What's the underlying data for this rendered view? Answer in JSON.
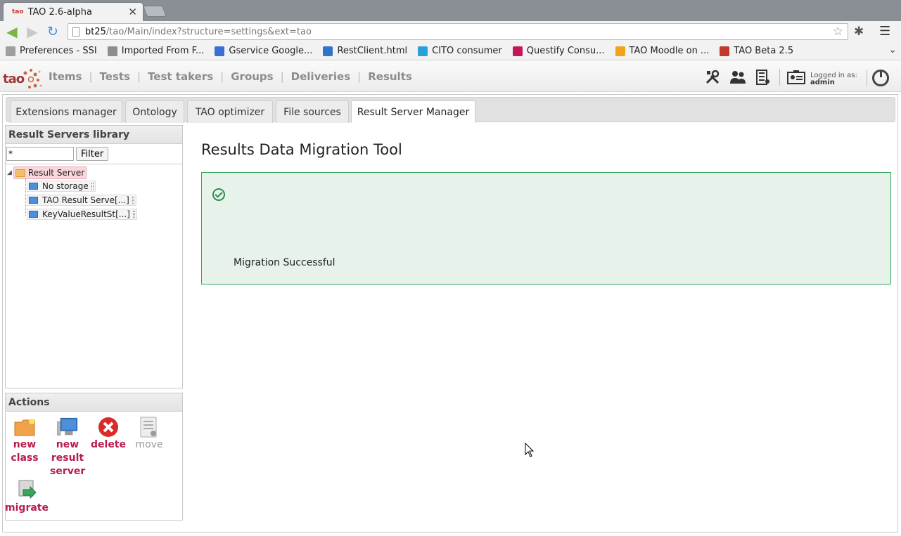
{
  "browser": {
    "tab_title": "TAO 2.6-alpha",
    "tab_favicon": "tao",
    "url_host": "bt25",
    "url_path": "/tao/Main/index?structure=settings&ext=tao",
    "bookmarks": [
      {
        "label": "Preferences - SSI",
        "icon_color": "#9e9e9e"
      },
      {
        "label": "Imported From F...",
        "icon_color": "#8d8d8d"
      },
      {
        "label": "Gservice Google...",
        "icon_color": "#3b6fd6"
      },
      {
        "label": "RestClient.html",
        "icon_color": "#2f74c9"
      },
      {
        "label": "CITO consumer",
        "icon_color": "#2aa0d8"
      },
      {
        "label": "Questify Consu...",
        "icon_color": "#c2185b"
      },
      {
        "label": "TAO Moodle on ...",
        "icon_color": "#f2a21b"
      },
      {
        "label": "TAO Beta 2.5",
        "icon_color": "#c0392b"
      }
    ]
  },
  "header": {
    "logo": "tao",
    "nav": [
      "Items",
      "Tests",
      "Test takers",
      "Groups",
      "Deliveries",
      "Results"
    ],
    "logged_in_label": "Logged in as:",
    "user": "admin"
  },
  "tabs": [
    {
      "label": "Extensions manager"
    },
    {
      "label": "Ontology"
    },
    {
      "label": "TAO optimizer"
    },
    {
      "label": "File sources"
    },
    {
      "label": "Result Server Manager"
    }
  ],
  "library": {
    "title": "Result Servers library",
    "filter_value": "*",
    "filter_button": "Filter",
    "root": "Result Server",
    "items": [
      "No storage",
      "TAO Result Serve[...]",
      "KeyValueResultSt[...]"
    ]
  },
  "actions": {
    "title": "Actions",
    "new_class": "new class",
    "new_result_server": "new result server",
    "delete": "delete",
    "move": "move",
    "migrate": "migrate"
  },
  "content": {
    "title": "Results Data Migration Tool",
    "message": "Migration Successful"
  },
  "colors": {
    "accent": "#b71c4e",
    "success_bg": "#e6f2ea",
    "success_border": "#36a560"
  }
}
